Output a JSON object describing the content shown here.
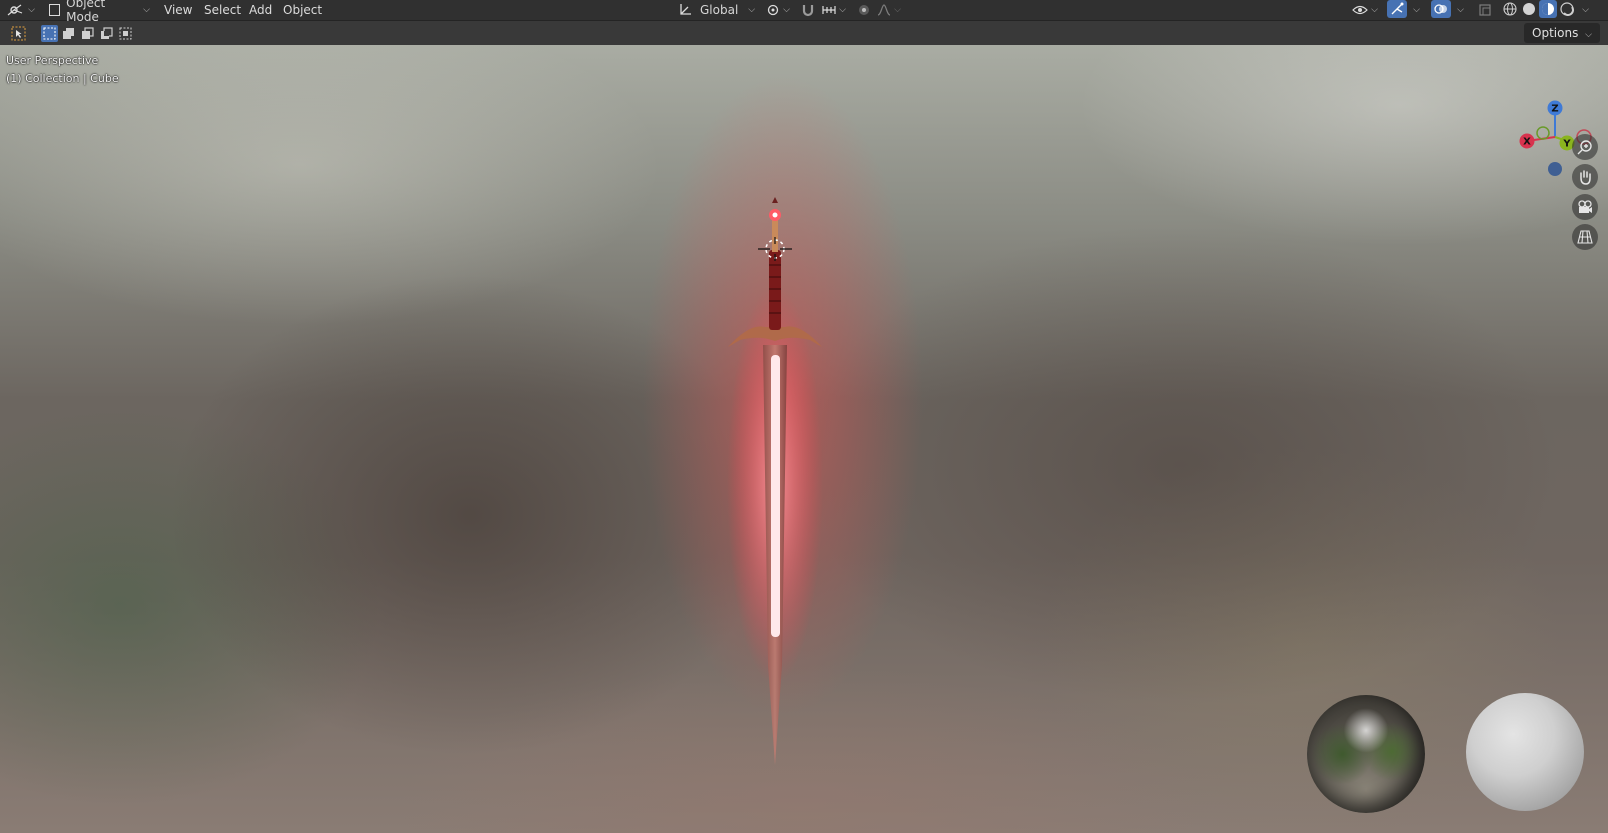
{
  "header": {
    "editor_type_icon": "3d-viewport-icon",
    "mode": {
      "icon": "object-mode-icon",
      "label": "Object Mode"
    },
    "menus": [
      "View",
      "Select",
      "Add",
      "Object"
    ],
    "transform_orientation": {
      "icon": "orientation-icon",
      "label": "Global"
    },
    "pivot_icon": "pivot-point-icon",
    "snap_icon": "snap-magnet-icon",
    "snap_target_icon": "snap-increment-icon",
    "proportional_icon": "proportional-edit-icon",
    "falloff_icon": "falloff-curve-icon",
    "right_icons": [
      "visibility-eye-icon",
      "gizmo-toggle-icon",
      "overlay-toggle-icon",
      "xray-icon"
    ],
    "shading_modes": [
      {
        "name": "wireframe",
        "icon": "wireframe-shading-icon",
        "active": false
      },
      {
        "name": "solid",
        "icon": "solid-shading-icon",
        "active": false
      },
      {
        "name": "material-preview",
        "icon": "material-shading-icon",
        "active": true
      },
      {
        "name": "rendered",
        "icon": "rendered-shading-icon",
        "active": false
      }
    ]
  },
  "toolbar": {
    "active_tool_icon": "select-tool-icon",
    "select_modes": [
      {
        "name": "set",
        "active": true
      },
      {
        "name": "extend",
        "active": false
      },
      {
        "name": "subtract",
        "active": false
      },
      {
        "name": "difference",
        "active": false
      },
      {
        "name": "intersect",
        "active": false
      }
    ],
    "options_label": "Options"
  },
  "viewport": {
    "view_name": "User Perspective",
    "collection_info": "(1) Collection | Cube",
    "gizmo": {
      "z": "Z",
      "y": "Y",
      "x": "X"
    },
    "nav_buttons": [
      "zoom-icon",
      "pan-hand-icon",
      "camera-view-icon",
      "ortho-grid-icon"
    ],
    "object": "sword",
    "accent_color": "#4772b3",
    "glow_color": "#ff3b4a"
  }
}
